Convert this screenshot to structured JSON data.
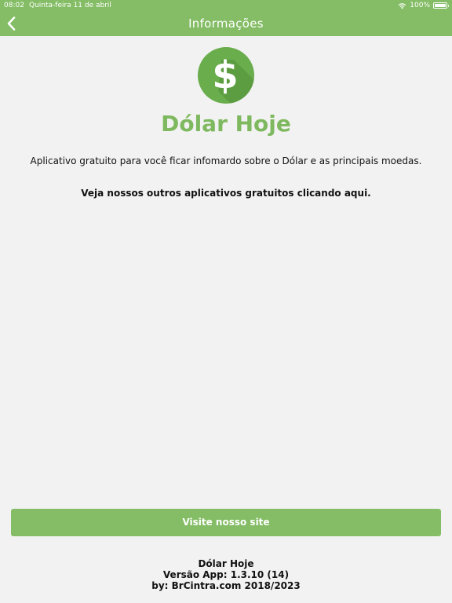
{
  "status_bar": {
    "time": "08:02",
    "date": "Quinta-feira 11 de abril",
    "battery": "100%"
  },
  "nav": {
    "title": "Informações",
    "back_icon": "chevron-left-icon"
  },
  "app": {
    "logo_icon": "dollar-sign-icon",
    "logo_symbol": "$",
    "name": "Dólar Hoje",
    "description": "Aplicativo gratuito para você ficar infomardo sobre o Dólar e as principais moedas.",
    "other_apps_link": "Veja nossos outros aplicativos gratuitos clicando aqui."
  },
  "actions": {
    "visit_site": "Visite nosso site"
  },
  "footer": {
    "app_name": "Dólar Hoje",
    "version": "Versão App: 1.3.10 (14)",
    "credits": "by: BrCintra.com 2018/2023"
  },
  "colors": {
    "brand_green": "#84bd65",
    "title_green": "#7fb95f",
    "logo_green": "#6aad4c",
    "logo_shadow": "#5a9a3f",
    "background": "#f2f2f2",
    "text": "#111111"
  }
}
